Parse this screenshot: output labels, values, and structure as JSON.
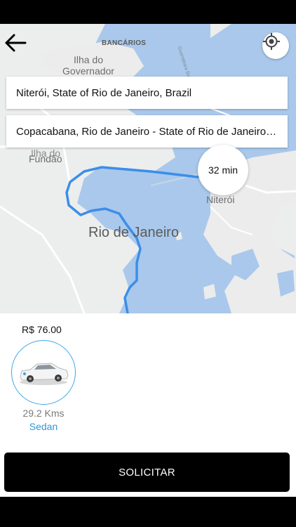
{
  "map": {
    "labels": {
      "bancarios": "BANCÁRIOS",
      "ilha_governador": "Ilha do\nGovernador",
      "fundao": "Fundão",
      "ilha_do": "Ilha do",
      "rio": "Rio de Janeiro",
      "niteroi": "Niterói",
      "road": "Guanabara Bay"
    },
    "colors": {
      "water": "#a9c8ec",
      "land": "#ececec",
      "route": "#3b8ee8"
    }
  },
  "search": {
    "origin": "Niterói, State of Rio de Janeiro, Brazil",
    "destination": "Copacabana, Rio de Janeiro - State of Rio de Janeiro, Brazil"
  },
  "eta": "32 min",
  "ride": {
    "price": "R$ 76.00",
    "distance": "29.2 Kms",
    "category": "Sedan"
  },
  "actions": {
    "request": "SOLICITAR"
  },
  "icons": {
    "back": "back-arrow-icon",
    "locate": "my-location-icon",
    "car": "sedan-car-icon"
  }
}
